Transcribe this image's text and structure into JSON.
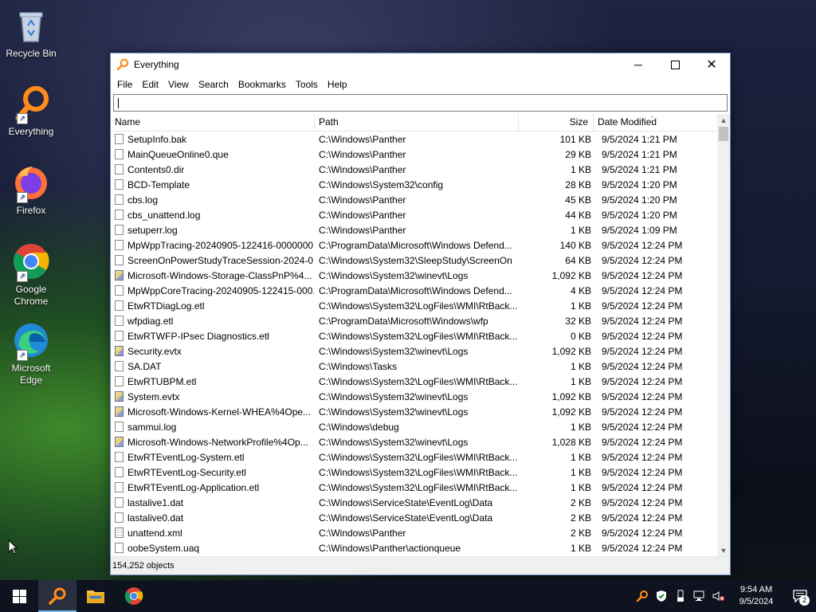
{
  "desktop": {
    "icons": [
      {
        "label": "Recycle Bin"
      },
      {
        "label": "Everything"
      },
      {
        "label": "Firefox"
      },
      {
        "label": "Google Chrome"
      },
      {
        "label": "Microsoft Edge"
      }
    ]
  },
  "window": {
    "title": "Everything",
    "menu": [
      "File",
      "Edit",
      "View",
      "Search",
      "Bookmarks",
      "Tools",
      "Help"
    ],
    "search_value": "",
    "columns": {
      "name": "Name",
      "path": "Path",
      "size": "Size",
      "date": "Date Modified"
    },
    "sort_column": "Date Modified",
    "rows": [
      {
        "name": "SetupInfo.bak",
        "path": "C:\\Windows\\Panther",
        "size": "101 KB",
        "date": "9/5/2024 1:21 PM",
        "icon": "file"
      },
      {
        "name": "MainQueueOnline0.que",
        "path": "C:\\Windows\\Panther",
        "size": "29 KB",
        "date": "9/5/2024 1:21 PM",
        "icon": "file"
      },
      {
        "name": "Contents0.dir",
        "path": "C:\\Windows\\Panther",
        "size": "1 KB",
        "date": "9/5/2024 1:21 PM",
        "icon": "file"
      },
      {
        "name": "BCD-Template",
        "path": "C:\\Windows\\System32\\config",
        "size": "28 KB",
        "date": "9/5/2024 1:20 PM",
        "icon": "file"
      },
      {
        "name": "cbs.log",
        "path": "C:\\Windows\\Panther",
        "size": "45 KB",
        "date": "9/5/2024 1:20 PM",
        "icon": "file"
      },
      {
        "name": "cbs_unattend.log",
        "path": "C:\\Windows\\Panther",
        "size": "44 KB",
        "date": "9/5/2024 1:20 PM",
        "icon": "file"
      },
      {
        "name": "setuperr.log",
        "path": "C:\\Windows\\Panther",
        "size": "1 KB",
        "date": "9/5/2024 1:09 PM",
        "icon": "file"
      },
      {
        "name": "MpWppTracing-20240905-122416-0000000...",
        "path": "C:\\ProgramData\\Microsoft\\Windows Defend...",
        "size": "140 KB",
        "date": "9/5/2024 12:24 PM",
        "icon": "file"
      },
      {
        "name": "ScreenOnPowerStudyTraceSession-2024-0...",
        "path": "C:\\Windows\\System32\\SleepStudy\\ScreenOn",
        "size": "64 KB",
        "date": "9/5/2024 12:24 PM",
        "icon": "file"
      },
      {
        "name": "Microsoft-Windows-Storage-ClassPnP%4...",
        "path": "C:\\Windows\\System32\\winevt\\Logs",
        "size": "1,092 KB",
        "date": "9/5/2024 12:24 PM",
        "icon": "evtx"
      },
      {
        "name": "MpWppCoreTracing-20240905-122415-000...",
        "path": "C:\\ProgramData\\Microsoft\\Windows Defend...",
        "size": "4 KB",
        "date": "9/5/2024 12:24 PM",
        "icon": "file"
      },
      {
        "name": "EtwRTDiagLog.etl",
        "path": "C:\\Windows\\System32\\LogFiles\\WMI\\RtBack...",
        "size": "1 KB",
        "date": "9/5/2024 12:24 PM",
        "icon": "file"
      },
      {
        "name": "wfpdiag.etl",
        "path": "C:\\ProgramData\\Microsoft\\Windows\\wfp",
        "size": "32 KB",
        "date": "9/5/2024 12:24 PM",
        "icon": "file"
      },
      {
        "name": "EtwRTWFP-IPsec Diagnostics.etl",
        "path": "C:\\Windows\\System32\\LogFiles\\WMI\\RtBack...",
        "size": "0 KB",
        "date": "9/5/2024 12:24 PM",
        "icon": "file"
      },
      {
        "name": "Security.evtx",
        "path": "C:\\Windows\\System32\\winevt\\Logs",
        "size": "1,092 KB",
        "date": "9/5/2024 12:24 PM",
        "icon": "evtx"
      },
      {
        "name": "SA.DAT",
        "path": "C:\\Windows\\Tasks",
        "size": "1 KB",
        "date": "9/5/2024 12:24 PM",
        "icon": "file"
      },
      {
        "name": "EtwRTUBPM.etl",
        "path": "C:\\Windows\\System32\\LogFiles\\WMI\\RtBack...",
        "size": "1 KB",
        "date": "9/5/2024 12:24 PM",
        "icon": "file"
      },
      {
        "name": "System.evtx",
        "path": "C:\\Windows\\System32\\winevt\\Logs",
        "size": "1,092 KB",
        "date": "9/5/2024 12:24 PM",
        "icon": "evtx"
      },
      {
        "name": "Microsoft-Windows-Kernel-WHEA%4Ope...",
        "path": "C:\\Windows\\System32\\winevt\\Logs",
        "size": "1,092 KB",
        "date": "9/5/2024 12:24 PM",
        "icon": "evtx"
      },
      {
        "name": "sammui.log",
        "path": "C:\\Windows\\debug",
        "size": "1 KB",
        "date": "9/5/2024 12:24 PM",
        "icon": "file"
      },
      {
        "name": "Microsoft-Windows-NetworkProfile%4Op...",
        "path": "C:\\Windows\\System32\\winevt\\Logs",
        "size": "1,028 KB",
        "date": "9/5/2024 12:24 PM",
        "icon": "evtx"
      },
      {
        "name": "EtwRTEventLog-System.etl",
        "path": "C:\\Windows\\System32\\LogFiles\\WMI\\RtBack...",
        "size": "1 KB",
        "date": "9/5/2024 12:24 PM",
        "icon": "file"
      },
      {
        "name": "EtwRTEventLog-Security.etl",
        "path": "C:\\Windows\\System32\\LogFiles\\WMI\\RtBack...",
        "size": "1 KB",
        "date": "9/5/2024 12:24 PM",
        "icon": "file"
      },
      {
        "name": "EtwRTEventLog-Application.etl",
        "path": "C:\\Windows\\System32\\LogFiles\\WMI\\RtBack...",
        "size": "1 KB",
        "date": "9/5/2024 12:24 PM",
        "icon": "file"
      },
      {
        "name": "lastalive1.dat",
        "path": "C:\\Windows\\ServiceState\\EventLog\\Data",
        "size": "2 KB",
        "date": "9/5/2024 12:24 PM",
        "icon": "file"
      },
      {
        "name": "lastalive0.dat",
        "path": "C:\\Windows\\ServiceState\\EventLog\\Data",
        "size": "2 KB",
        "date": "9/5/2024 12:24 PM",
        "icon": "file"
      },
      {
        "name": "unattend.xml",
        "path": "C:\\Windows\\Panther",
        "size": "2 KB",
        "date": "9/5/2024 12:24 PM",
        "icon": "xml"
      },
      {
        "name": "oobeSystem.uaq",
        "path": "C:\\Windows\\Panther\\actionqueue",
        "size": "1 KB",
        "date": "9/5/2024 12:24 PM",
        "icon": "file"
      }
    ],
    "status": "154,252 objects"
  },
  "taskbar": {
    "clock_time": "9:54 AM",
    "clock_date": "9/5/2024",
    "notification_count": "2",
    "accent": "#76b9ed"
  }
}
